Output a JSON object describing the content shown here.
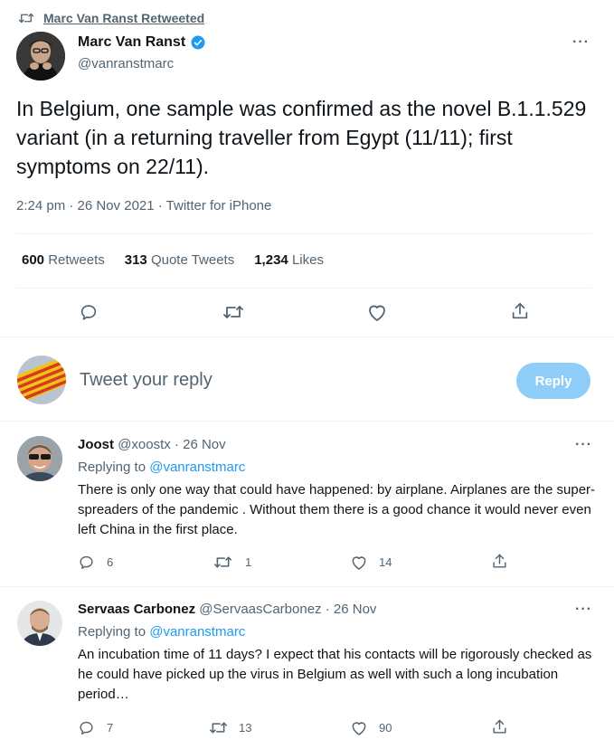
{
  "retweet_header": {
    "label": "Marc Van Ranst Retweeted"
  },
  "main_tweet": {
    "author_name": "Marc Van Ranst",
    "handle": "@vanranstmarc",
    "text": "In Belgium,  one sample was confirmed as the novel B.1.1.529 variant (in a returning traveller from Egypt (11/11); first symptoms on 22/11).",
    "meta": "2:24 pm · 26 Nov 2021 · Twitter for iPhone",
    "more": "···"
  },
  "stats": {
    "retweets_count": "600",
    "retweets_label": "Retweets",
    "quotes_count": "313",
    "quotes_label": "Quote Tweets",
    "likes_count": "1,234",
    "likes_label": "Likes"
  },
  "composer": {
    "placeholder": "Tweet your reply",
    "button_label": "Reply"
  },
  "replies": [
    {
      "name": "Joost",
      "handle": "@xoostx",
      "time": "· 26 Nov",
      "replying_prefix": "Replying to",
      "replying_to": "@vanranstmarc",
      "text": "There is only one way that could have happened: by airplane. Airplanes are the super-spreaders of the pandemic . Without them there is a good chance it would never even left China in the first place.",
      "reply_count": "6",
      "retweet_count": "1",
      "like_count": "14",
      "more": "···"
    },
    {
      "name": "Servaas Carbonez",
      "handle": "@ServaasCarbonez",
      "time": "· 26 Nov",
      "replying_prefix": "Replying to",
      "replying_to": "@vanranstmarc",
      "text": "An incubation time of 11 days? I expect that his contacts will be rigorously checked as he could have picked up the virus in Belgium as well with such a long incubation period…",
      "reply_count": "7",
      "retweet_count": "13",
      "like_count": "90",
      "more": "···"
    }
  ],
  "colors": {
    "accent": "#1d9bf0",
    "reply_button_disabled": "#8ecdf8",
    "muted_text": "#536471"
  }
}
